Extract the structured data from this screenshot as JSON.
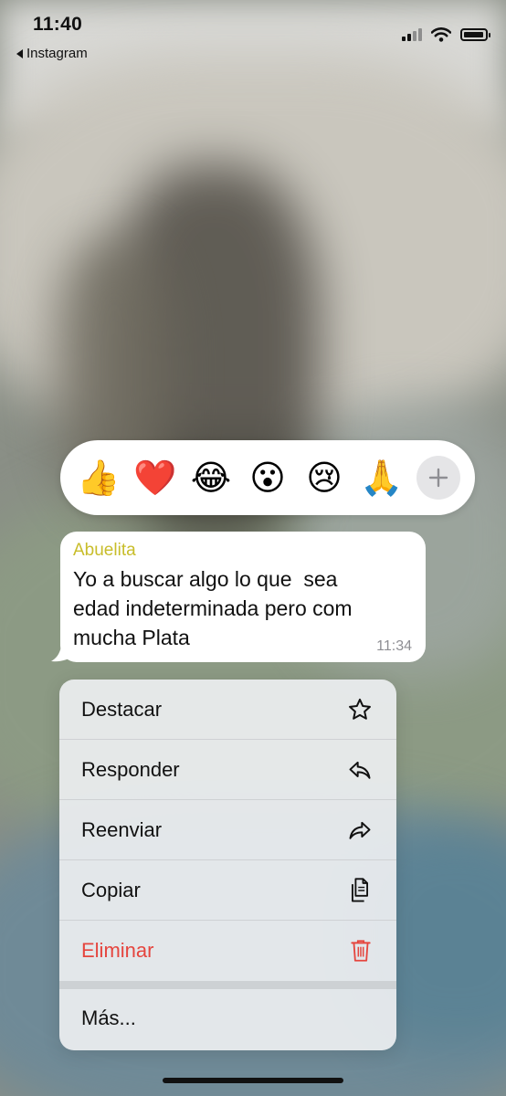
{
  "status_bar": {
    "time": "11:40",
    "back_app": "Instagram"
  },
  "reactions": {
    "emojis": [
      "👍",
      "❤️",
      "😂",
      "😮",
      "😢",
      "🙏"
    ],
    "add_icon": "plus-icon"
  },
  "message": {
    "sender": "Abuelita",
    "sender_color": "#c8bd2a",
    "text": "Yo a buscar algo lo que  sea\nedad indeterminada pero com\nmucha Plata",
    "time": "11:34"
  },
  "menu": {
    "items": [
      {
        "label": "Destacar",
        "icon": "star-icon"
      },
      {
        "label": "Responder",
        "icon": "reply-icon"
      },
      {
        "label": "Reenviar",
        "icon": "forward-icon"
      },
      {
        "label": "Copiar",
        "icon": "copy-icon"
      },
      {
        "label": "Eliminar",
        "icon": "trash-icon",
        "color": "#e5453e"
      },
      {
        "label": "Más...",
        "icon": ""
      }
    ]
  }
}
